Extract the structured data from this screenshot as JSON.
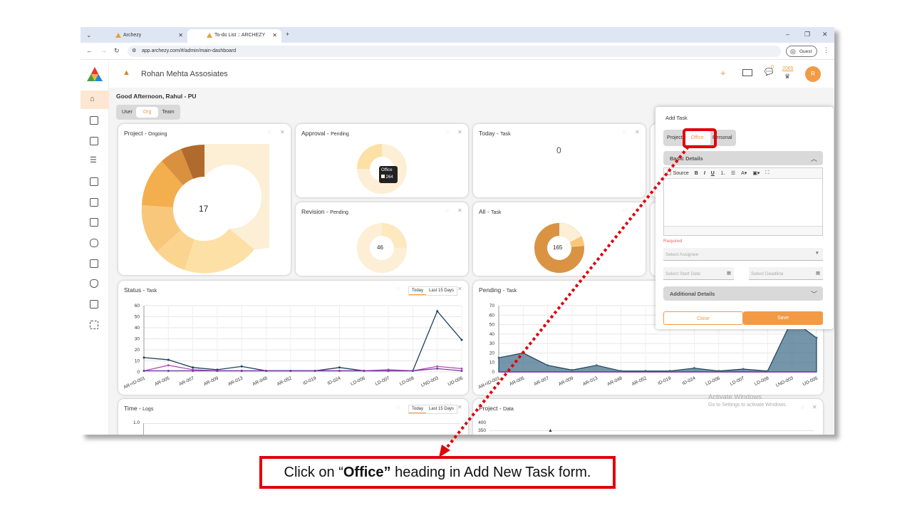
{
  "browser": {
    "tabs": [
      {
        "label": "Archezy"
      },
      {
        "label": "To-do List :: ARCHEZY"
      }
    ],
    "url": "app.archezy.com/#/admin/main-dashboard",
    "profile_label": "Guest"
  },
  "header": {
    "company": "Rohan Mehta Assosiates",
    "notif_count": "0",
    "points": "2065",
    "avatar_letter": "R"
  },
  "greeting": "Good Afternoon, Rahul - PU",
  "scope_toggle": [
    "User",
    "Org",
    "Team"
  ],
  "cards": {
    "project": {
      "title": "Project",
      "sub": "Ongoing",
      "center": "17"
    },
    "approval": {
      "title": "Approval",
      "sub": "Pending",
      "tooltip_title": "Office",
      "tooltip_value": "264"
    },
    "today": {
      "title": "Today",
      "sub": "Task",
      "value": "0"
    },
    "revision": {
      "title": "Revision",
      "sub": "Pending",
      "center": "46"
    },
    "all": {
      "title": "All",
      "sub": "Task",
      "center": "165"
    },
    "status": {
      "title": "Status",
      "sub": "Task",
      "toggle": [
        "Today",
        "Last 15 Days"
      ]
    },
    "pending": {
      "title": "Pending",
      "sub": "Task"
    },
    "time": {
      "title": "Time",
      "sub": "Logs",
      "toggle": [
        "Today",
        "Last 15 Days"
      ]
    },
    "projectdata": {
      "title": "Project",
      "sub": "Data"
    }
  },
  "chart_data": [
    {
      "type": "line",
      "title": "Status - Task",
      "categories": [
        "AR+ID-001",
        "AR-005",
        "AR-007",
        "AR-009",
        "AR-013",
        "AR-048",
        "AR-052",
        "ID-019",
        "ID-024",
        "LD-006",
        "LD-007",
        "LD-008",
        "LND-003",
        "UD-005"
      ],
      "yticks": [
        "0",
        "10",
        "20",
        "30",
        "40",
        "50",
        "60"
      ],
      "ylim": [
        0,
        60
      ],
      "series": [
        {
          "color": "#1d3f5a",
          "values": [
            13,
            11,
            4,
            2,
            5,
            1,
            1,
            1,
            4,
            1,
            1,
            1,
            55,
            29
          ]
        },
        {
          "color": "#b04fb0",
          "values": [
            1,
            6,
            2,
            1,
            1,
            1,
            1,
            1,
            1,
            1,
            2,
            1,
            5,
            3
          ]
        },
        {
          "color": "#7a3aa8",
          "values": [
            1,
            1,
            1,
            1,
            1,
            1,
            1,
            1,
            1,
            1,
            1,
            1,
            3,
            1
          ]
        }
      ]
    },
    {
      "type": "area",
      "title": "Pending - Task",
      "categories": [
        "AR+ID-001",
        "AR-005",
        "AR-007",
        "AR-009",
        "AR-013",
        "AR-048",
        "AR-052",
        "ID-019",
        "ID-024",
        "LD-006",
        "LD-007",
        "LD-008",
        "LND-003",
        "UD-005"
      ],
      "yticks": [
        "0",
        "10",
        "20",
        "30",
        "40",
        "50",
        "60",
        "70"
      ],
      "ylim": [
        0,
        70
      ],
      "series": [
        {
          "color": "#3b6a86",
          "values": [
            15,
            20,
            7,
            2,
            7,
            1,
            1,
            1,
            4,
            1,
            3,
            1,
            55,
            36
          ]
        }
      ]
    },
    {
      "type": "line",
      "title": "Time - Logs",
      "yticks": [
        "1.0"
      ],
      "ylim": [
        0,
        1
      ]
    },
    {
      "type": "line",
      "title": "Project - Data",
      "yticks": [
        "400",
        "350"
      ],
      "ylim": [
        0,
        400
      ]
    }
  ],
  "add_task": {
    "title": "Add Task",
    "tabs": [
      "Project",
      "Office",
      "Personal"
    ],
    "basic_details": "Basic Details",
    "toolbar_source": "Source",
    "required": "Required",
    "assignee_placeholder": "Select Assignee",
    "start_date_placeholder": "Select Start Date",
    "deadline_placeholder": "Select Deadline",
    "additional_details": "Additional Details",
    "close_label": "Close",
    "save_label": "Save"
  },
  "watermark": {
    "line1": "Activate Windows",
    "line2": "Go to Settings to activate Windows."
  },
  "instruction": {
    "prefix": "Click on “",
    "bold": "Office”",
    "suffix": " heading in Add New Task form."
  },
  "colors": {
    "accent": "#f39a45",
    "callout": "#e0040b",
    "line_navy": "#1d3f5a"
  }
}
